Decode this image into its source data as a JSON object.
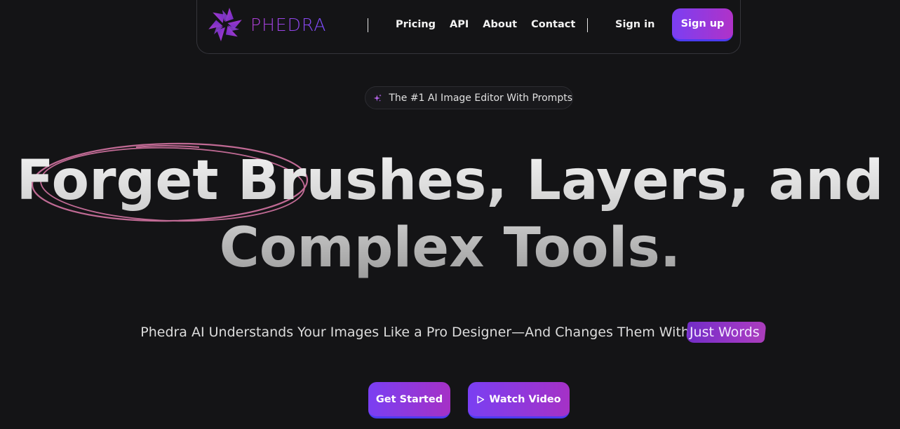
{
  "nav": {
    "brand": "PHEDRA",
    "links": [
      "Pricing",
      "API",
      "About",
      "Contact"
    ],
    "signin": "Sign in",
    "signup": "Sign up"
  },
  "badge": {
    "icon": "sparkles-icon",
    "text": "The #1 AI Image Editor With Prompts"
  },
  "hero": {
    "headline_line1": "Forget Brushes, Layers, and",
    "headline_line2": "Complex Tools.",
    "subhead_main": "Phedra AI Understands Your Images Like a Pro Designer—And Changes Them With",
    "subhead_highlight": "Just Words"
  },
  "cta": {
    "get_started": "Get Started",
    "watch_video": "Watch Video",
    "watch_icon": "play-icon"
  },
  "colors": {
    "background": "#141416",
    "accent_start": "#7b3ff2",
    "accent_end": "#b032c8",
    "scribble": "#c06a94"
  }
}
